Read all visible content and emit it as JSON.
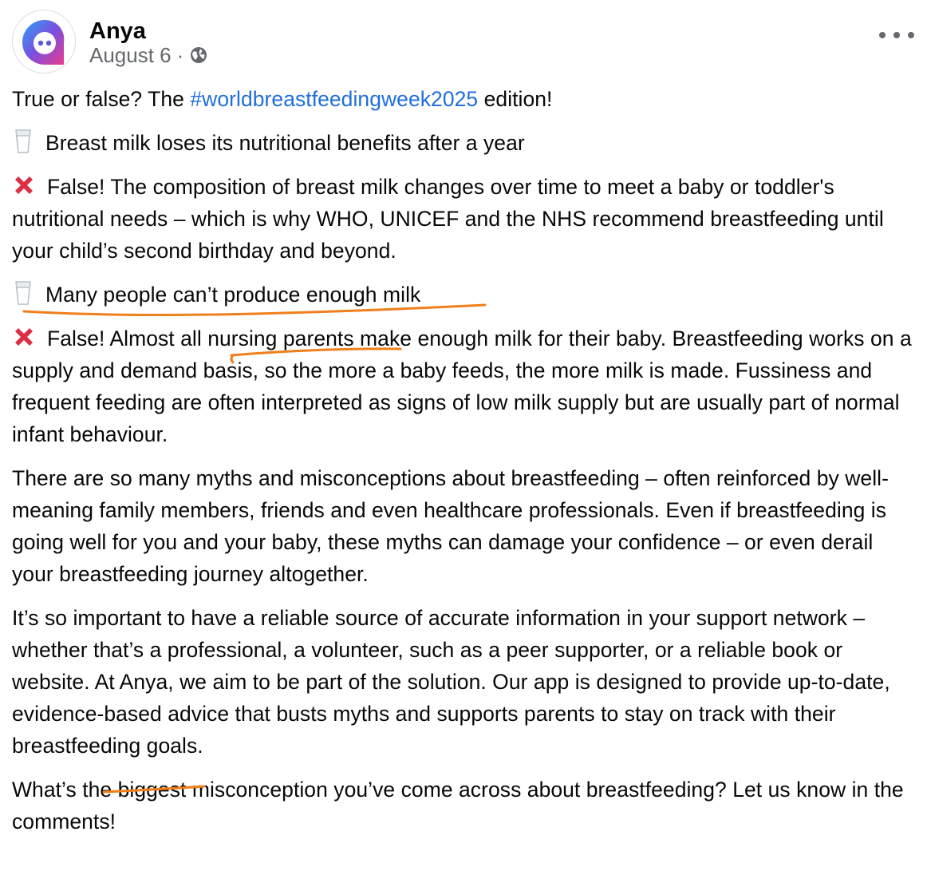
{
  "post": {
    "author": "Anya",
    "date": "August 6",
    "separator": "·",
    "privacy_icon": "globe-icon",
    "more_icon": "more-options-icon",
    "intro_prefix": "True or false? The ",
    "hashtag": "#worldbreastfeedingweek2025",
    "intro_suffix": " edition!",
    "claim1": "Breast milk loses its nutritional benefits after a year",
    "answer1": "False! The composition of breast milk changes over time to meet a baby or toddler's nutritional needs – which is why WHO, UNICEF and the NHS recommend breastfeeding until your child’s second birthday and beyond.",
    "claim2": "Many people can’t produce enough milk",
    "answer2_prefix": "False! Almost all ",
    "answer2_highlight": "nursing parents",
    "answer2_suffix": " make enough milk for their baby. Breastfeeding works on a supply and demand basis, so the more a baby feeds, the more milk is made. Fussiness and frequent feeding are often interpreted as signs of low milk supply but are usually part of normal infant behaviour.",
    "paragraph_myths": "There are so many myths and misconceptions about breastfeeding – often reinforced by well-meaning family members, friends and even healthcare professionals. Even if breastfeeding is going well for you and your baby, these myths can damage your confidence – or even derail your breastfeeding journey altogether.",
    "paragraph_support_prefix": "It’s so important to have a reliable source of accurate information in your support network – whether that’s a professional, a volunteer, such as a peer supporter, or a reliable book or website. At Anya, we aim to be part of the solution. Our app is designed to provide up-to-date, evidence-based advice that busts myths and supports ",
    "paragraph_support_highlight": "parents",
    "paragraph_support_suffix": " to stay on track with their breastfeeding goals.",
    "closing_question": "What’s the biggest misconception you’ve come across about breastfeeding? Let us know in the comments!"
  },
  "colors": {
    "hashtag": "#216fdb",
    "meta_text": "#65686c",
    "annotation": "#f07f1c",
    "cross": "#dd2e44",
    "avatar_gradient": [
      "#2ba3f5",
      "#7a4fe0",
      "#e93c8d"
    ]
  }
}
